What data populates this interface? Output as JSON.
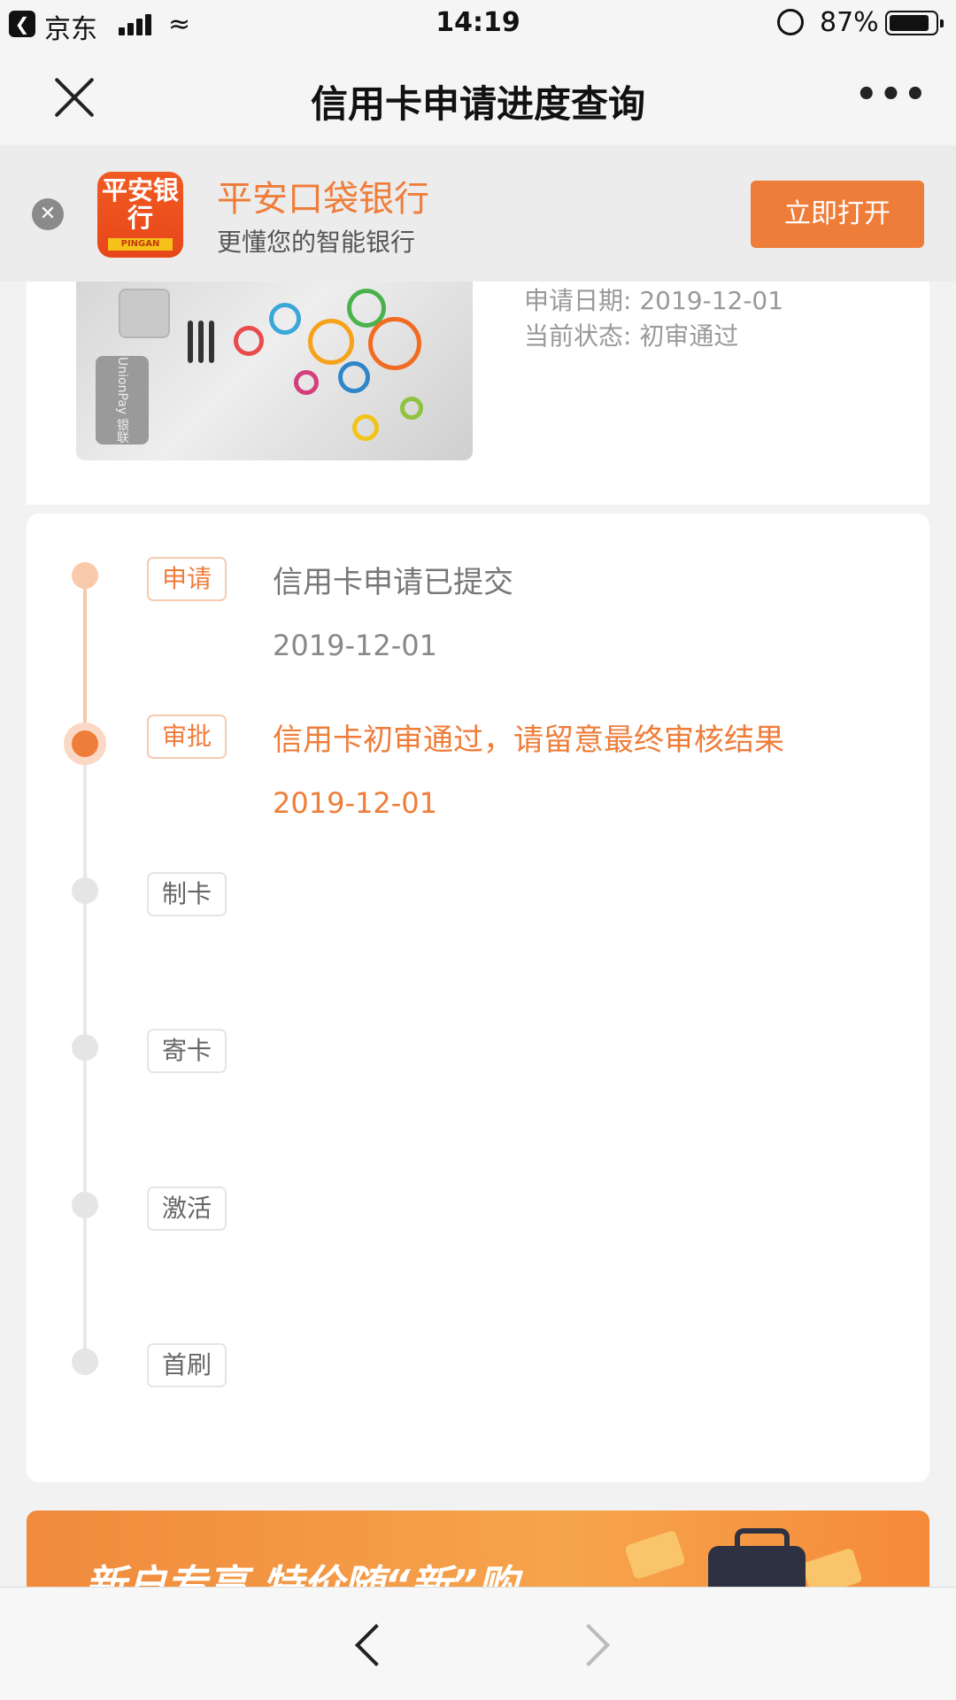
{
  "status_bar": {
    "back_app": "京东",
    "time": "14:19",
    "battery": "87%"
  },
  "nav": {
    "title": "信用卡申请进度查询",
    "more": "•••"
  },
  "app_banner": {
    "logo_text": "平安银行",
    "logo_sub": "PINGAN",
    "name": "平安口袋银行",
    "tagline": "更懂您的智能银行",
    "open_label": "立即打开"
  },
  "card_info": {
    "date": "申请日期: 2019-12-01",
    "status": "当前状态: 初审通过",
    "unionpay": "UnionPay 银联"
  },
  "timeline": {
    "steps": [
      {
        "tag": "申请",
        "desc": "信用卡申请已提交",
        "date": "2019-12-01",
        "state": "done"
      },
      {
        "tag": "审批",
        "desc": "信用卡初审通过，请留意最终审核结果",
        "date": "2019-12-01",
        "state": "current"
      },
      {
        "tag": "制卡",
        "state": "pending"
      },
      {
        "tag": "寄卡",
        "state": "pending"
      },
      {
        "tag": "激活",
        "state": "pending"
      },
      {
        "tag": "首刷",
        "state": "pending"
      }
    ]
  },
  "promo": {
    "text": "新户专享 特价随“新”购"
  },
  "colors": {
    "accent": "#ef7d3a",
    "accent_light": "#f9c9ab",
    "inactive": "#e5e5e5"
  }
}
